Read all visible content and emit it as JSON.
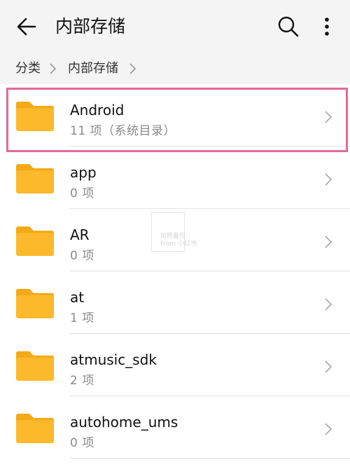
{
  "header": {
    "title": "内部存储",
    "back_icon": "arrow-left-icon",
    "search_icon": "search-icon",
    "more_icon": "more-vertical-icon"
  },
  "breadcrumb": {
    "items": [
      "分类",
      "内部存储"
    ]
  },
  "files": [
    {
      "name": "Android",
      "meta": "11 项（系统目录）",
      "icon": "folder-icon"
    },
    {
      "name": "app",
      "meta": "0 项",
      "icon": "folder-icon"
    },
    {
      "name": "AR",
      "meta": "0 项",
      "icon": "folder-icon"
    },
    {
      "name": "at",
      "meta": "1 项",
      "icon": "folder-icon"
    },
    {
      "name": "atmusic_sdk",
      "meta": "2 项",
      "icon": "folder-icon"
    },
    {
      "name": "autohome_ums",
      "meta": "0 项",
      "icon": "folder-icon"
    }
  ],
  "watermark": {
    "line1": "拍照备份",
    "line2": "From 小红书"
  },
  "colors": {
    "highlight": "#e36a98",
    "folder": "#fbb92b",
    "folder_tab": "#f4a917",
    "bar_background": "#f4f4f4"
  }
}
